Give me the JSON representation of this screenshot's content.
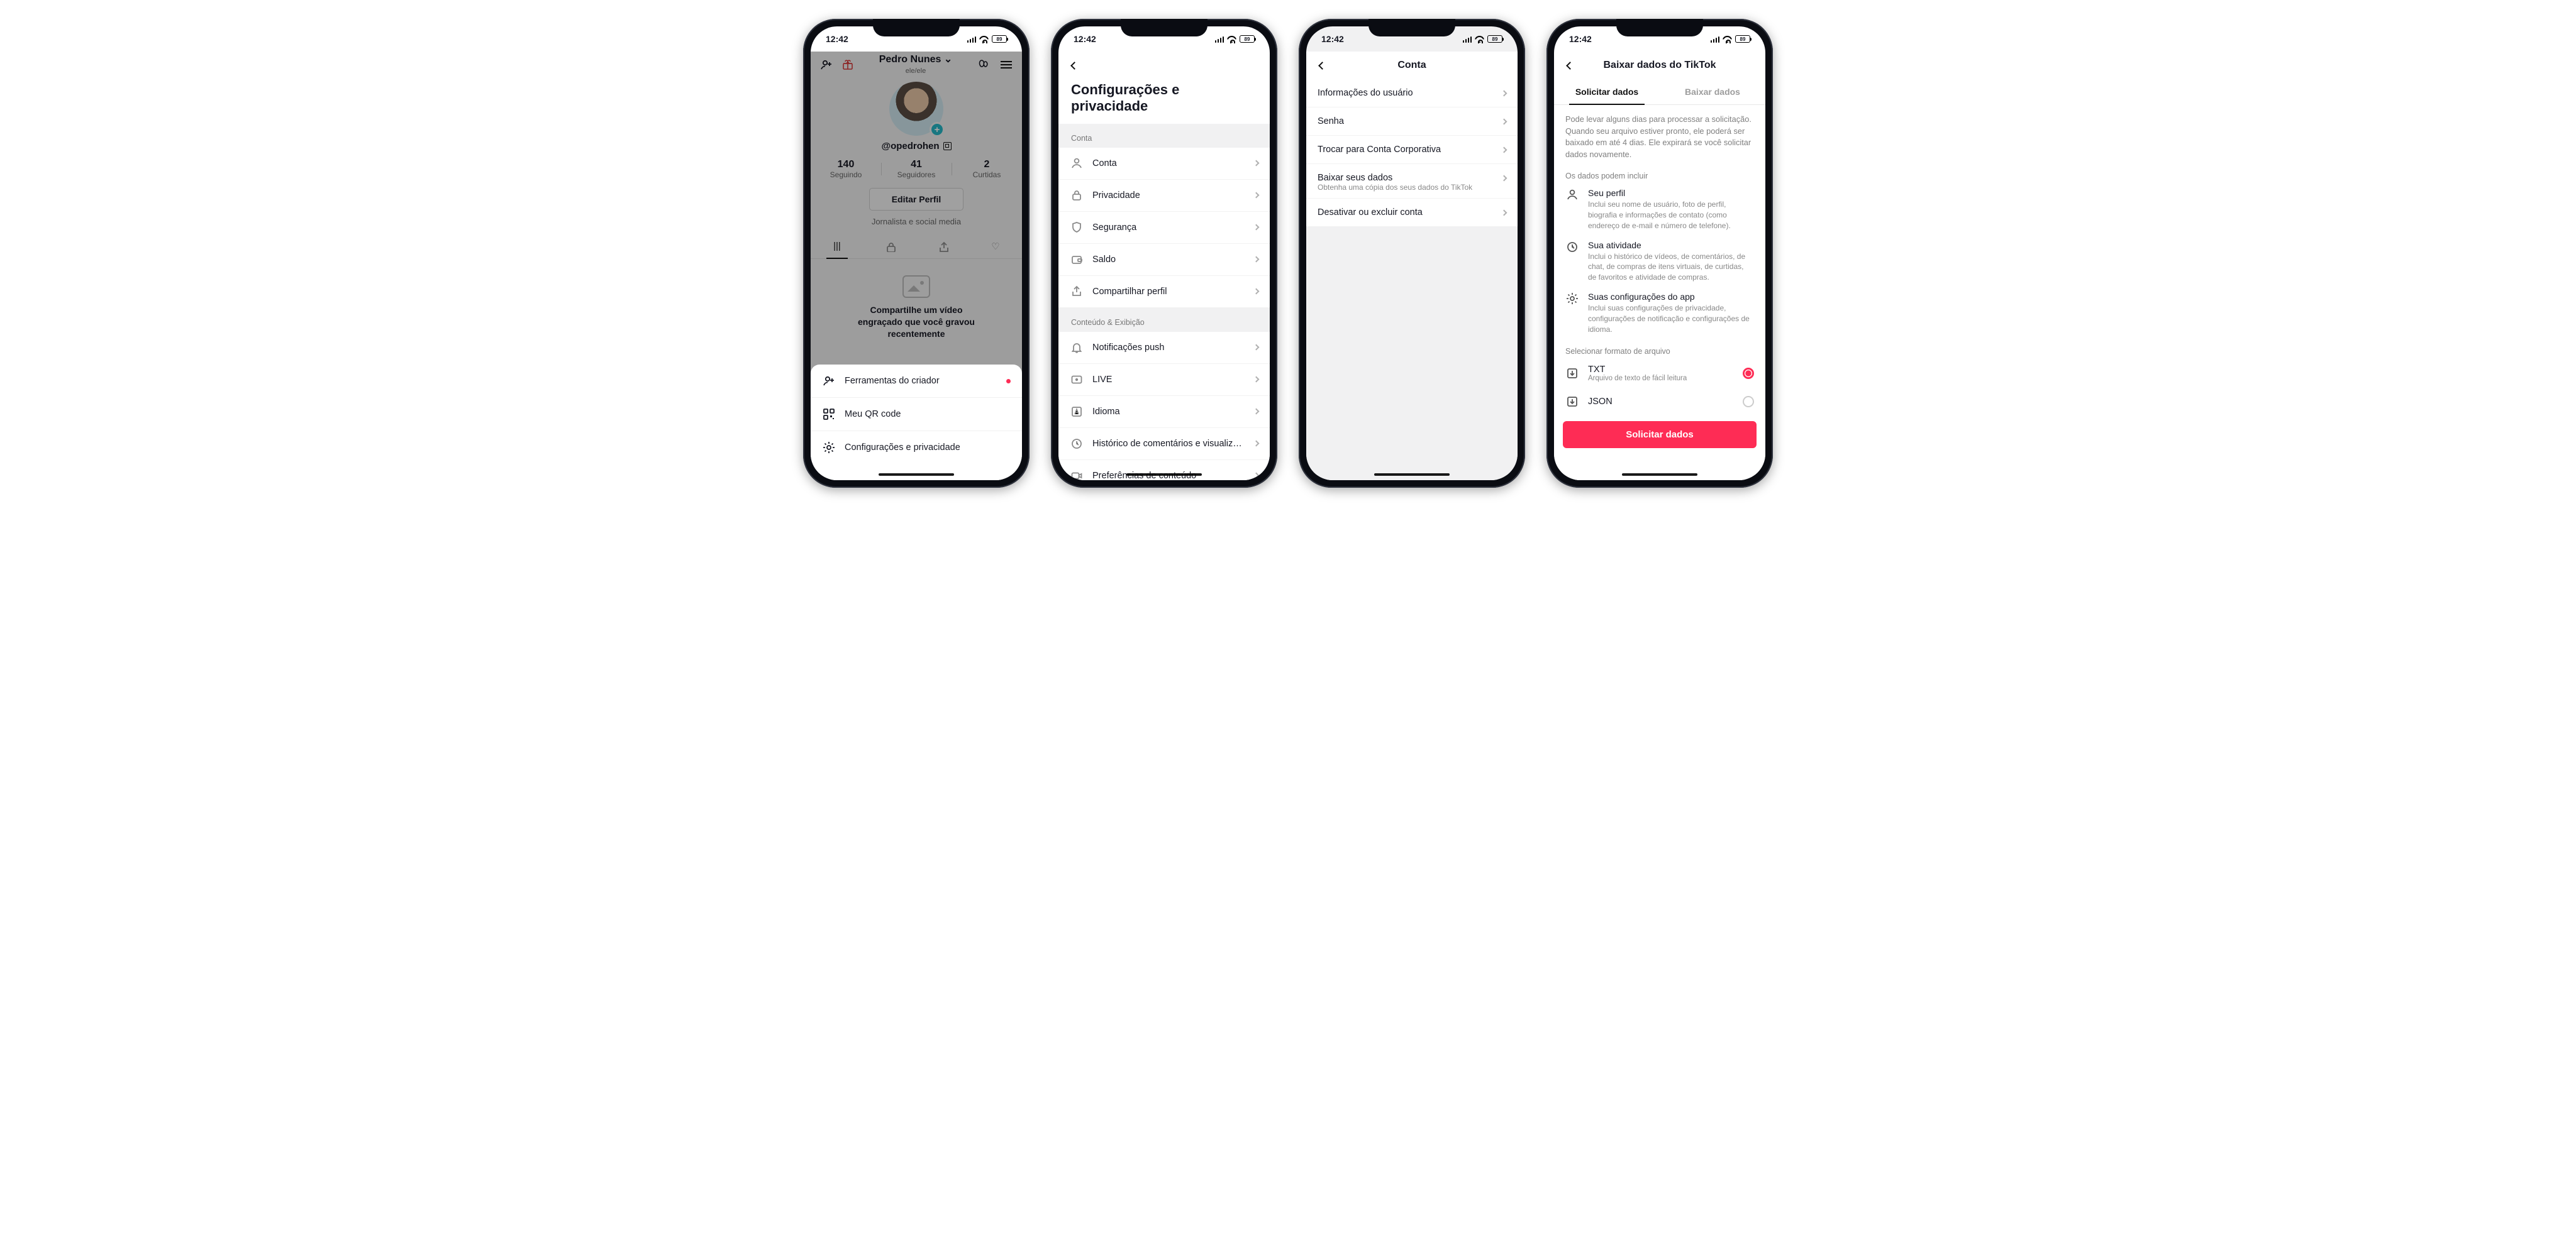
{
  "status": {
    "time": "12:42",
    "battery": "89"
  },
  "screen1": {
    "header": {
      "name": "Pedro Nunes",
      "pronouns": "ele/ele",
      "name_chevron": "⌄"
    },
    "handle": "@opedrohen",
    "stats": [
      {
        "value": "140",
        "label": "Seguindo"
      },
      {
        "value": "41",
        "label": "Seguidores"
      },
      {
        "value": "2",
        "label": "Curtidas"
      }
    ],
    "edit_label": "Editar Perfil",
    "bio": "Jornalista e social media",
    "empty_prompt_l1": "Compartilhe um vídeo",
    "empty_prompt_l2": "engraçado que você gravou",
    "empty_prompt_l3": "recentemente",
    "sheet": [
      {
        "label": "Ferramentas do criador",
        "badge": true
      },
      {
        "label": "Meu QR code"
      },
      {
        "label": "Configurações e privacidade"
      }
    ]
  },
  "screen2": {
    "title": "Configurações e privacidade",
    "groups": [
      {
        "heading": "Conta",
        "items": [
          {
            "icon": "user",
            "label": "Conta"
          },
          {
            "icon": "lock",
            "label": "Privacidade"
          },
          {
            "icon": "shield",
            "label": "Segurança"
          },
          {
            "icon": "wallet",
            "label": "Saldo"
          },
          {
            "icon": "share",
            "label": "Compartilhar perfil"
          }
        ]
      },
      {
        "heading": "Conteúdo & Exibição",
        "items": [
          {
            "icon": "bell",
            "label": "Notificações push"
          },
          {
            "icon": "live",
            "label": "LIVE"
          },
          {
            "icon": "lang",
            "label": "Idioma"
          },
          {
            "icon": "clock",
            "label": "Histórico de comentários e visualiza..."
          },
          {
            "icon": "video",
            "label": "Preferências de conteúdo"
          }
        ]
      }
    ]
  },
  "screen3": {
    "title": "Conta",
    "items": [
      {
        "label": "Informações do usuário"
      },
      {
        "label": "Senha"
      },
      {
        "label": "Trocar para Conta Corporativa"
      },
      {
        "label": "Baixar seus dados",
        "sub": "Obtenha uma cópia dos seus dados do TikTok"
      },
      {
        "label": "Desativar ou excluir conta"
      }
    ]
  },
  "screen4": {
    "title": "Baixar dados do TikTok",
    "tabs": {
      "request": "Solicitar dados",
      "download": "Baixar dados"
    },
    "intro": "Pode levar alguns dias para processar a solicitação. Quando seu arquivo estiver pronto, ele poderá ser baixado em até 4 dias. Ele expirará se você solicitar dados novamente.",
    "include_heading": "Os dados podem incluir",
    "includes": [
      {
        "icon": "user",
        "title": "Seu perfil",
        "desc": "Inclui seu nome de usuário, foto de perfil, biografia e informações de contato (como endereço de e-mail e número de telefone)."
      },
      {
        "icon": "clock",
        "title": "Sua atividade",
        "desc": "Inclui o histórico de vídeos, de comentários, de chat, de compras de itens virtuais, de curtidas, de favoritos e atividade de compras."
      },
      {
        "icon": "gear",
        "title": "Suas configurações do app",
        "desc": "Inclui suas configurações de privacidade, configurações de notificação e configurações de idioma."
      }
    ],
    "format_heading": "Selecionar formato de arquivo",
    "formats": [
      {
        "name": "TXT",
        "desc": "Arquivo de texto de fácil leitura",
        "selected": true
      },
      {
        "name": "JSON",
        "desc": "",
        "selected": false
      }
    ],
    "cta": "Solicitar dados"
  }
}
